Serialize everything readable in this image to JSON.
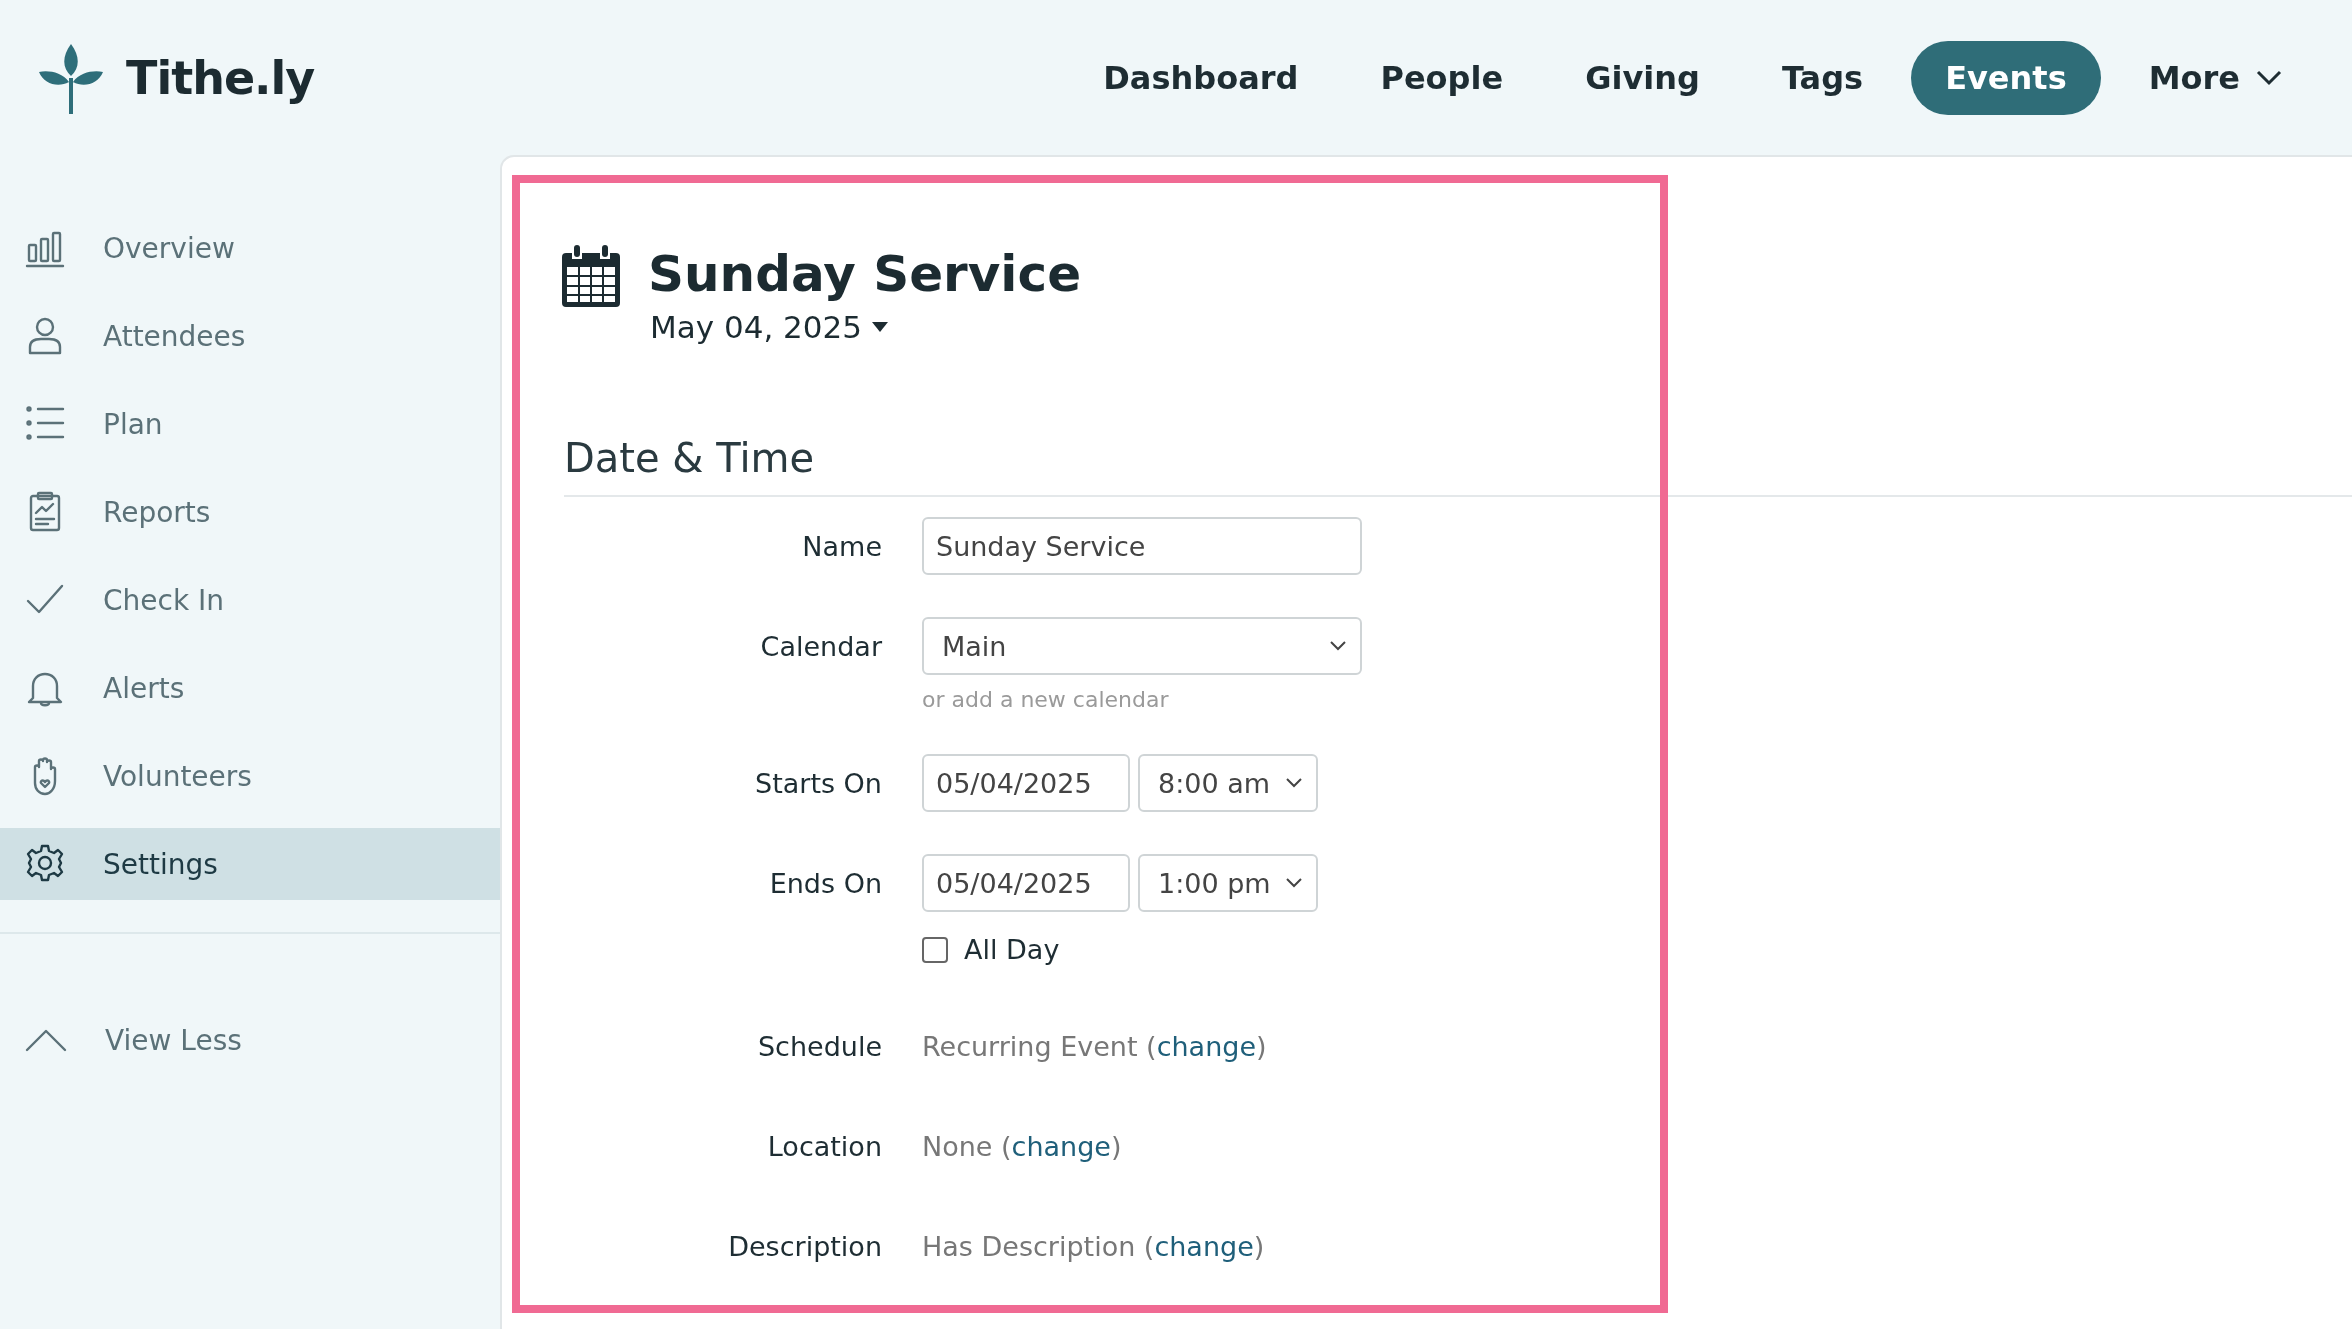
{
  "brand": {
    "name": "Tithe.ly"
  },
  "nav": [
    {
      "label": "Dashboard",
      "selected": false
    },
    {
      "label": "People",
      "selected": false
    },
    {
      "label": "Giving",
      "selected": false
    },
    {
      "label": "Tags",
      "selected": false
    },
    {
      "label": "Events",
      "selected": true
    },
    {
      "label": "More",
      "selected": false,
      "kind": "dropdown"
    }
  ],
  "sidebar": {
    "items": [
      {
        "label": "Overview",
        "selected": false
      },
      {
        "label": "Attendees",
        "selected": false
      },
      {
        "label": "Plan",
        "selected": false
      },
      {
        "label": "Reports",
        "selected": false
      },
      {
        "label": "Check In",
        "selected": false
      },
      {
        "label": "Alerts",
        "selected": false
      },
      {
        "label": "Volunteers",
        "selected": false
      },
      {
        "label": "Settings",
        "selected": true
      }
    ],
    "toggle": {
      "label": "View Less"
    }
  },
  "event": {
    "title": "Sunday Service",
    "date": "May 04, 2025",
    "section": "Date & Time",
    "fields": [
      {
        "kind": "text",
        "label": "Name",
        "value": "Sunday Service"
      },
      {
        "kind": "select",
        "label": "Calendar",
        "value": "Main",
        "hint": "or add a new calendar"
      },
      {
        "kind": "datetime",
        "label": "Starts On",
        "date": "05/04/2025",
        "time": "8:00 am"
      },
      {
        "kind": "datetime",
        "label": "Ends On",
        "date": "05/04/2025",
        "time": "1:00 pm",
        "checkbox": {
          "label": "All Day",
          "checked": false
        }
      },
      {
        "kind": "link",
        "label": "Schedule",
        "before": "Recurring Event (",
        "link": "change",
        "after": ")"
      },
      {
        "kind": "link",
        "label": "Location",
        "before": "None (",
        "link": "change",
        "after": ")"
      },
      {
        "kind": "link",
        "label": "Description",
        "before": "Has Description (",
        "link": "change",
        "after": ")"
      }
    ]
  }
}
